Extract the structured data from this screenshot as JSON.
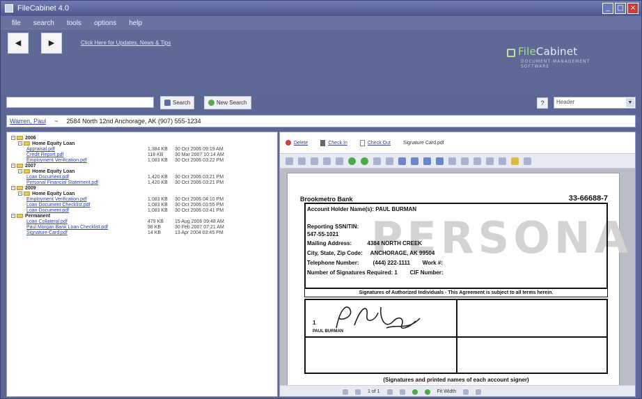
{
  "window": {
    "title": "FileCabinet 4.0"
  },
  "menu": [
    "file",
    "search",
    "tools",
    "options",
    "help"
  ],
  "nav": {
    "back_label": "◀",
    "forward_label": "▶"
  },
  "header": {
    "link_text": "Click Here for Updates, News & Tips"
  },
  "logo": {
    "brand_part1": "File",
    "brand_part2": "Cabinet",
    "tagline": "DOCUMENT MANAGEMENT SOFTWARE"
  },
  "search": {
    "value": "",
    "search_label": "Search",
    "new_label": "New Search",
    "select_value": "Header",
    "small_btn": "?"
  },
  "client": {
    "name": "Warren, Paul",
    "separator": "~",
    "address": "2584 North 12nd Anchorage, AK (907) 555-1234"
  },
  "tree": [
    {
      "type": "folder",
      "level": 0,
      "label": "2006"
    },
    {
      "type": "folder",
      "level": 1,
      "label": "Home Equity Loan"
    },
    {
      "type": "file",
      "name": "Appraisal.pdf",
      "size": "1,384 KB",
      "date": "30 Oct 2006 09:19 AM"
    },
    {
      "type": "file",
      "name": "Credit Report.pdf",
      "size": "118 KB",
      "date": "30 Mar 2007 10:14 AM"
    },
    {
      "type": "file",
      "name": "Employment Verification.pdf",
      "size": "1,083 KB",
      "date": "30 Oct 2006 03:22 PM"
    },
    {
      "type": "folder",
      "level": 0,
      "label": "2007"
    },
    {
      "type": "folder",
      "level": 1,
      "label": "Home Equity Loan"
    },
    {
      "type": "file",
      "name": "Loan Document.pdf",
      "size": "1,420 KB",
      "date": "30 Oct 2006 03:21 PM"
    },
    {
      "type": "file",
      "name": "Personal Financial Statement.pdf",
      "size": "1,420 KB",
      "date": "30 Oct 2006 03:21 PM"
    },
    {
      "type": "folder",
      "level": 0,
      "label": "2009"
    },
    {
      "type": "folder",
      "level": 1,
      "label": "Home Equity Loan"
    },
    {
      "type": "file",
      "name": "Employment Verification.pdf",
      "size": "1,083 KB",
      "date": "30 Oct 2006 04:10 PM"
    },
    {
      "type": "file",
      "name": "Loan Document Checklist.pdf",
      "size": "1,083 KB",
      "date": "30 Oct 2006 03:55 PM"
    },
    {
      "type": "file",
      "name": "Loan Document.pdf",
      "size": "1,083 KB",
      "date": "30 Oct 2006 03:41 PM"
    },
    {
      "type": "folder",
      "level": 0,
      "label": "Permanent"
    },
    {
      "type": "file",
      "name": "Loan Collateral.pdf",
      "size": "479 KB",
      "date": "15 Aug 2006 09:48 AM"
    },
    {
      "type": "file",
      "name": "Paul Morgan Bank Loan Checklist.pdf",
      "size": "98 KB",
      "date": "30 Feb 2007 07:21 AM"
    },
    {
      "type": "file",
      "name": "Signature Card.pdf",
      "size": "14 KB",
      "date": "13 Apr 2004 03:45 PM"
    }
  ],
  "viewer": {
    "delete_label": "Delete",
    "view_label": "Check In",
    "edit_label": "Check Out",
    "filename": "Signature Card.pdf",
    "page_info": "1 of 1",
    "zoom": "Fit Width"
  },
  "document": {
    "bank": "Brookmetro Bank",
    "acct_no": "33-66688-7",
    "watermark": "PERSONAL",
    "rows": [
      "Account Holder Name(s): PAUL BURMAN",
      "Reporting SSN/TIN:",
      "547-55-1021",
      "Mailing Address:          4384 NORTH CREEK",
      "City, State, Zip Code:     ANCHORAGE, AK 99504",
      "Telephone Number:         (444) 222-1111        Work #:",
      "Number of Signatures Required: 1        CIF Number:"
    ],
    "sig_header": "Signatures of Authorized Individuals - This Agreement is subject to all terms herein.",
    "sig_number": "1",
    "sig_name": "PAUL BURMAN",
    "sig_caption": "(Signatures and printed names of each account signer)"
  }
}
